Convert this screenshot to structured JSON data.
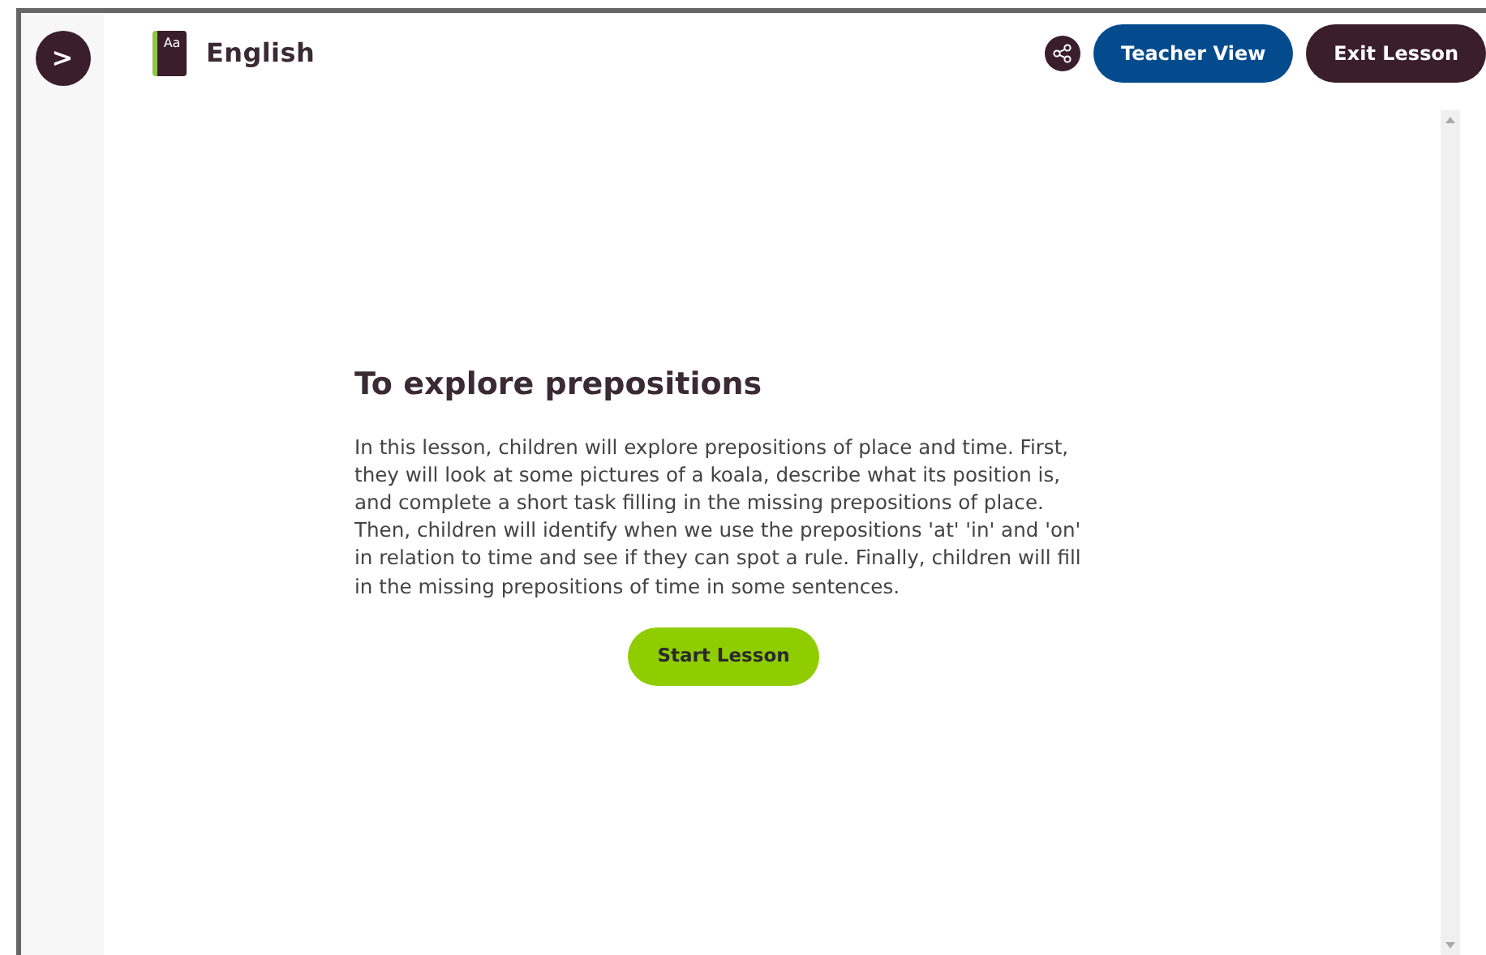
{
  "header": {
    "sidebar_toggle": ">",
    "subject_icon_text": "Aa",
    "subject": "English",
    "buttons": [
      {
        "label": "Teacher View",
        "kind": "primary"
      },
      {
        "label": "Exit Lesson",
        "kind": "dark"
      }
    ]
  },
  "lesson": {
    "title": "To explore prepositions",
    "description": "In this lesson, children will explore prepositions of place and time. First, they will look at some pictures of a koala, describe what its position is, and complete a short task filling in the missing prepositions of place. Then, children will identify when we use the prepositions 'at' 'in' and 'on' in relation to time and see if they can spot a rule. Finally, children will fill in the missing prepositions of time in some sentences.",
    "button": "Start Lesson"
  }
}
